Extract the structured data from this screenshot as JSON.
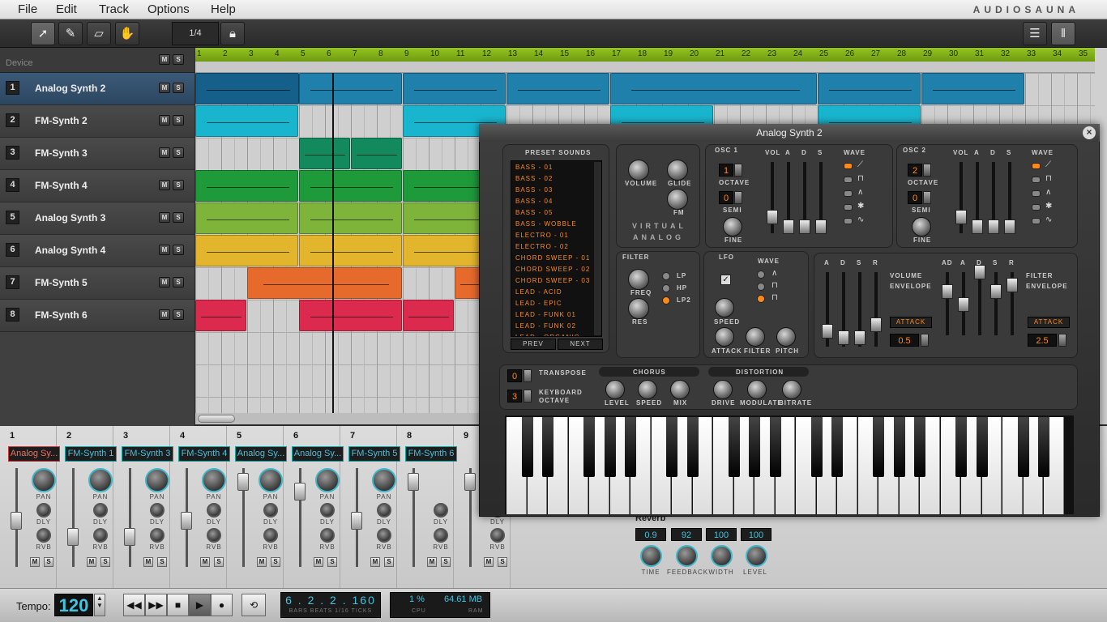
{
  "menu": {
    "items": [
      "File",
      "Edit",
      "Track",
      "Options",
      "Help"
    ],
    "brand": "AUDIOSAUNA"
  },
  "toolbar": {
    "quantize": "1/4"
  },
  "tracks": {
    "header_label": "Device",
    "items": [
      {
        "num": "1",
        "name": "Analog Synth 2"
      },
      {
        "num": "2",
        "name": "FM-Synth 2"
      },
      {
        "num": "3",
        "name": "FM-Synth 3"
      },
      {
        "num": "4",
        "name": "FM-Synth 4"
      },
      {
        "num": "5",
        "name": "Analog Synth 3"
      },
      {
        "num": "6",
        "name": "Analog Synth 4"
      },
      {
        "num": "7",
        "name": "FM-Synth 5"
      },
      {
        "num": "8",
        "name": "FM-Synth 6"
      }
    ],
    "mute_label": "M",
    "solo_label": "S"
  },
  "ruler": {
    "bars": [
      "1",
      "2",
      "3",
      "4",
      "5",
      "6",
      "7",
      "8",
      "9",
      "10",
      "11",
      "12",
      "13",
      "14",
      "15",
      "16",
      "17",
      "18",
      "19",
      "20",
      "21",
      "22",
      "23",
      "24",
      "25",
      "26",
      "27",
      "28",
      "29",
      "30",
      "31",
      "32",
      "33",
      "34",
      "35"
    ]
  },
  "colors": {
    "track1": "#1f80ab",
    "track2": "#19b5cf",
    "track3": "#138a5e",
    "track4": "#1e9a3a",
    "track5": "#7fb43a",
    "track6": "#e3b52c",
    "track7": "#e56a2c",
    "track8": "#dc2a4e",
    "accent": "#41c4e0",
    "orange": "#ff8a1a"
  },
  "mixer": {
    "channels": [
      {
        "num": "1",
        "name": "Analog Sy...",
        "selected": true
      },
      {
        "num": "2",
        "name": "FM-Synth 1"
      },
      {
        "num": "3",
        "name": "FM-Synth 3"
      },
      {
        "num": "4",
        "name": "FM-Synth 4"
      },
      {
        "num": "5",
        "name": "Analog Sy..."
      },
      {
        "num": "6",
        "name": "Analog Sy..."
      },
      {
        "num": "7",
        "name": "FM-Synth 5"
      },
      {
        "num": "8",
        "name": "FM-Synth 6"
      },
      {
        "num": "9",
        "name": ""
      }
    ],
    "pan_label": "PAN",
    "dly_label": "DLY",
    "rvb_label": "RVB",
    "reverb": {
      "title": "Reverb",
      "values": [
        "0.9",
        "92",
        "100",
        "100"
      ],
      "labels": [
        "TIME",
        "FEEDBACK",
        "WIDTH",
        "LEVEL"
      ]
    }
  },
  "transport": {
    "tempo_label": "Tempo:",
    "tempo": "120",
    "position": "6 . 2 . 2 . 160",
    "position_sub": "BARS  BEATS  1/16  TICKS",
    "cpu": "1 %",
    "cpu_label": "CPU",
    "ram": "64.61 MB",
    "ram_label": "RAM"
  },
  "synth": {
    "title": "Analog Synth 2",
    "preset_title": "PRESET SOUNDS",
    "presets": [
      "BASS - 01",
      "BASS - 02",
      "BASS - 03",
      "BASS - 04",
      "BASS - 05",
      "BASS - WOBBLE",
      "ELECTRO - 01",
      "ELECTRO - 02",
      "CHORD SWEEP - 01",
      "CHORD SWEEP - 02",
      "CHORD SWEEP - 03",
      "LEAD - ACID",
      "LEAD - EPIC",
      "LEAD - FUNK 01",
      "LEAD - FUNK 02",
      "LEAD - ORGANIC"
    ],
    "prev": "PREV",
    "next": "NEXT",
    "volume": "VOLUME",
    "glide": "GLIDE",
    "fm": "FM",
    "logo1": "VIRTUAL",
    "logo2": "ANALOG",
    "osc1": "OSC 1",
    "osc2": "OSC 2",
    "octave": "OCTAVE",
    "semi": "SEMI",
    "fine": "FINE",
    "osc1_octave": "1",
    "osc1_semi": "0",
    "osc2_octave": "2",
    "osc2_semi": "0",
    "vol": "VOL",
    "a": "A",
    "d": "D",
    "s": "S",
    "r": "R",
    "wave": "WAVE",
    "filter": "FILTER",
    "freq": "FREQ",
    "res": "RES",
    "lp": "LP",
    "hp": "HP",
    "lp2": "LP2",
    "lfo": "LFO",
    "speed": "SPEED",
    "attack": "ATTACK",
    "filter_k": "FILTER",
    "pitch": "PITCH",
    "volume_env": "VOLUME",
    "envelope": "ENVELOPE",
    "filter_env": "FILTER",
    "ad": "AD",
    "attack_btn": "ATTACK",
    "vol_env_val": "0.5",
    "filt_env_val": "2.5",
    "transpose": "TRANSPOSE",
    "transpose_val": "0",
    "keyboard": "KEYBOARD",
    "octave2": "OCTAVE",
    "kb_octave_val": "3",
    "chorus": "CHORUS",
    "distortion": "DISTORTION",
    "level": "LEVEL",
    "mix": "MIX",
    "drive": "DRIVE",
    "modulate": "MODULATE",
    "bitrate": "BITRATE"
  }
}
